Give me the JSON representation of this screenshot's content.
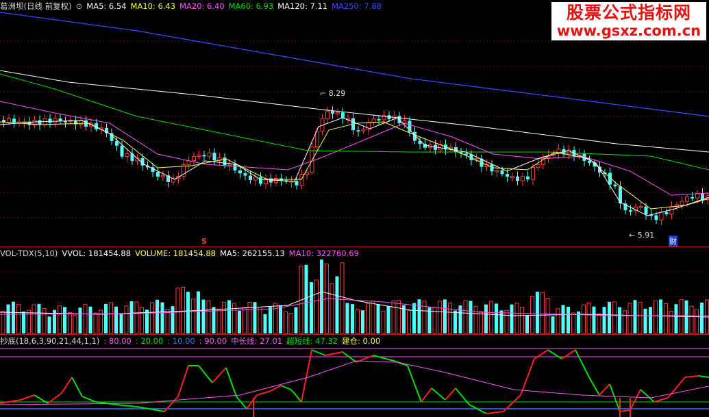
{
  "price_panel": {
    "legend": {
      "stock": "葛洲坝(日线 前复权)",
      "ma5": "MA5: 6.54",
      "ma10": "MA10: 6.43",
      "ma20": "MA20: 6.40",
      "ma60": "MA60: 6.93",
      "ma120": "MA120: 7.11",
      "ma250": "MA250: 7.88"
    },
    "high_label": "8.29",
    "low_label": "5.91",
    "marker_s": "S",
    "marker_cai": "财",
    "colors": {
      "up": "#ff3c3c",
      "down": "#54fcfc",
      "ma5": "#ffffff",
      "ma10": "#ffff54",
      "ma20": "#ff54ff",
      "ma60": "#00e000",
      "ma120": "#ffffff",
      "ma250": "#3a4cff"
    }
  },
  "volume_panel": {
    "legend": {
      "name": "VOL-TDX(5,10)",
      "vvol": "VVOL: 181454.88",
      "volume": "VOLUME: 181454.88",
      "ma5": "MA5: 262155.13",
      "ma10": "MA10: 322760.69"
    }
  },
  "indicator_panel": {
    "legend": {
      "name": "抄底(18,6,3,90,21,44,1,1)",
      "l80": ": 80.00",
      "l20": ": 20.00",
      "l10": ": 10.00",
      "l90": ": 90.00",
      "mid": "中长线: 27.01",
      "super": "超短线: 47.32",
      "build": "建仓: 0.00"
    }
  },
  "watermark": {
    "line1": "股票公式指标网",
    "line2": "www.gsxz.com.cn"
  },
  "chart_data": {
    "type": "line",
    "series": [
      {
        "name": "MA250",
        "values": [
          7.88
        ]
      },
      {
        "name": "MA120",
        "values": [
          7.11
        ]
      },
      {
        "name": "MA60",
        "values": [
          6.93
        ]
      },
      {
        "name": "MA20",
        "values": [
          6.4
        ]
      },
      {
        "name": "MA10",
        "values": [
          6.43
        ]
      },
      {
        "name": "MA5",
        "values": [
          6.54
        ]
      }
    ],
    "price_annotations": {
      "high": 8.29,
      "low": 5.91
    },
    "volume": {
      "vvol": 181454.88,
      "ma5": 262155.13,
      "ma10": 322760.69
    },
    "indicator": {
      "levels": [
        80,
        20,
        10,
        90
      ],
      "mid_line": 27.01,
      "short_line": 47.32,
      "build": 0
    }
  }
}
